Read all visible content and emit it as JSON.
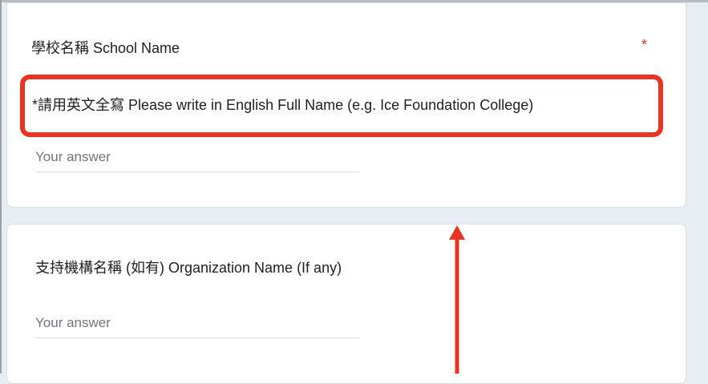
{
  "questions": [
    {
      "title": "學校名稱 School Name",
      "required_mark": "*",
      "description": "*請用英文全寫 Please write in English Full Name (e.g. Ice Foundation College)",
      "answer_placeholder": "Your answer"
    },
    {
      "title": "支持機構名稱 (如有) Organization Name (If any)",
      "answer_placeholder": "Your answer"
    }
  ],
  "colors": {
    "required_star": "#d93025",
    "annotation": "#ea3323",
    "card_background": "#ffffff",
    "page_background": "#e8edf3"
  },
  "icons": {
    "annotation_arrow": "arrow-up-icon"
  }
}
